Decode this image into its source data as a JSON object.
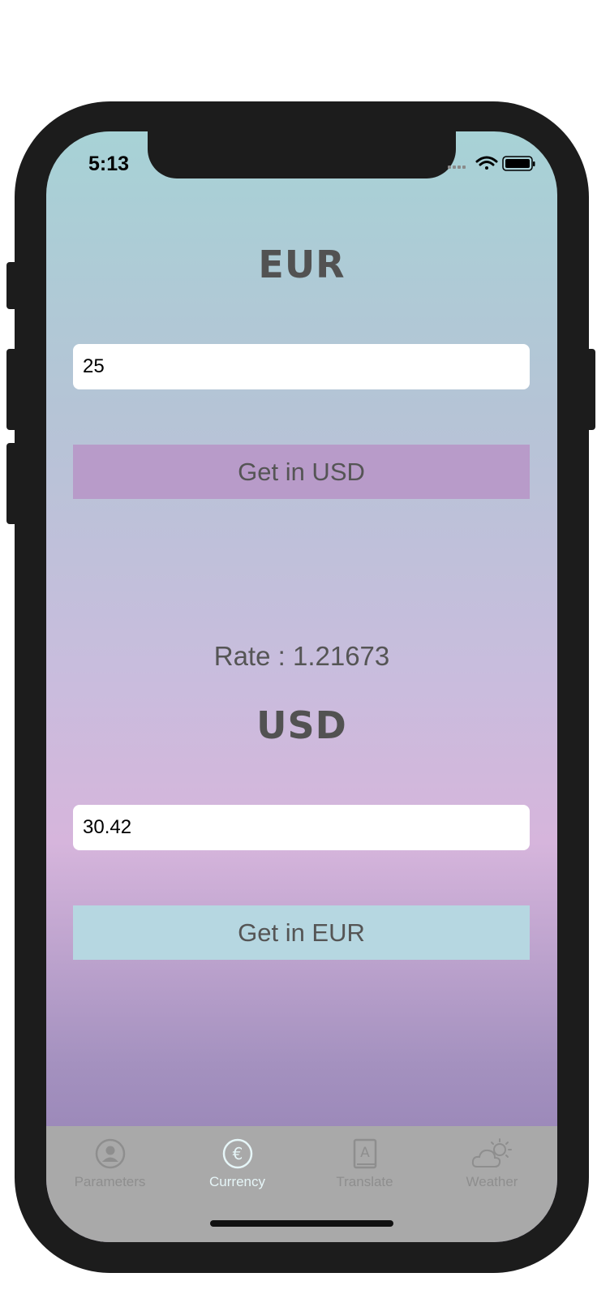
{
  "status_bar": {
    "time": "5:13"
  },
  "source": {
    "currency": "EUR",
    "amount": "25",
    "button_label": "Get in USD"
  },
  "rate": {
    "text": "Rate : 1.21673"
  },
  "target": {
    "currency": "USD",
    "amount": "30.42",
    "button_label": "Get in EUR"
  },
  "tab_bar": {
    "active_index": 1,
    "tabs": [
      {
        "label": "Parameters",
        "icon": "person-circle-icon"
      },
      {
        "label": "Currency",
        "icon": "euro-circle-icon"
      },
      {
        "label": "Translate",
        "icon": "dictionary-icon"
      },
      {
        "label": "Weather",
        "icon": "partly-cloudy-icon"
      }
    ]
  },
  "colors": {
    "convert_usd_button": "#b89bc9",
    "convert_eur_button": "#b6d7e1",
    "tab_bar": "#a9a9a9",
    "active_tab": "#e6f6f8",
    "inactive_tab": "#8e8e8e",
    "heading_text": "#525252"
  }
}
